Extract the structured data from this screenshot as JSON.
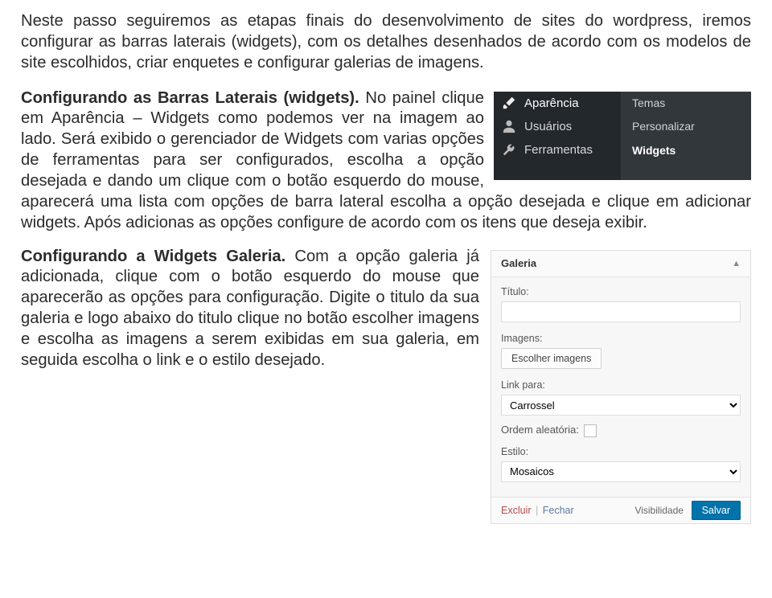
{
  "intro": "Neste passo seguiremos as etapas finais do desenvolvimento de sites do wordpress, iremos configurar as barras laterais (widgets), com os detalhes desenhados de acordo com os modelos de site escolhidos, criar enquetes e configurar galerias de imagens.",
  "sec2": {
    "title": "Configurando as Barras Laterais (widgets).",
    "text_a": " No painel clique em Aparência – Widgets como podemos ver na imagem ao lado. Será exibido o gerenciador de Widgets com varias opções de ferramentas para ser configurados, escolha a opção desejada e dando um clique com o botão esquerdo do mouse, aparecerá uma lista com opções de barra lateral escolha a opção desejada e clique em adicionar widgets. Após adicionas as opções configure de acordo com os itens que deseja exibir."
  },
  "wp_menu": {
    "left": [
      {
        "label": "Aparência",
        "active": true,
        "icon": "brush"
      },
      {
        "label": "Usuários",
        "active": false,
        "icon": "user"
      },
      {
        "label": "Ferramentas",
        "active": false,
        "icon": "wrench"
      }
    ],
    "right": [
      {
        "label": "Temas",
        "active": false
      },
      {
        "label": "Personalizar",
        "active": false
      },
      {
        "label": "Widgets",
        "active": true
      }
    ]
  },
  "sec3": {
    "title": "Configurando a Widgets Galeria.",
    "text": " Com a opção galeria já adicionada, clique com o botão esquerdo do mouse que aparecerão as opções para configuração. Digite o titulo da sua galeria e logo abaixo do titulo clique no botão escolher imagens e escolha as imagens a serem exibidas em sua galeria, em seguida escolha o link e o estilo desejado."
  },
  "galeria": {
    "header": "Galeria",
    "title_label": "Título:",
    "images_label": "Imagens:",
    "choose_btn": "Escolher imagens",
    "link_label": "Link para:",
    "link_value": "Carrossel",
    "random_label": "Ordem aleatória:",
    "style_label": "Estilo:",
    "style_value": "Mosaicos",
    "delete": "Excluir",
    "sep": "|",
    "close": "Fechar",
    "visibility": "Visibilidade",
    "save": "Salvar"
  }
}
